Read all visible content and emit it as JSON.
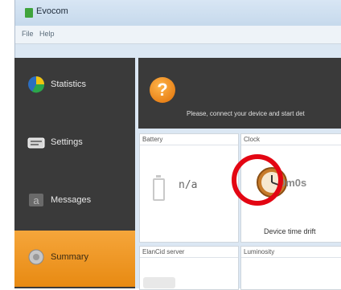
{
  "window": {
    "title": "Evocom"
  },
  "menu": [
    "File",
    "Help"
  ],
  "sidebar": {
    "items": [
      {
        "label": "Statistics",
        "icon": "statistics-icon",
        "active": false
      },
      {
        "label": "Settings",
        "icon": "settings-icon",
        "active": false
      },
      {
        "label": "Messages",
        "icon": "messages-icon",
        "active": false
      },
      {
        "label": "Summary",
        "icon": "summary-icon",
        "active": true
      }
    ]
  },
  "banner": {
    "icon": "question-icon",
    "icon_text": "?",
    "message": "Please, connect your device and start det"
  },
  "panels": {
    "battery": {
      "title": "Battery",
      "value": "n/a"
    },
    "clock": {
      "title": "Clock",
      "value": "0m0s",
      "caption": "Device time drift"
    },
    "elancid": {
      "title": "ElanCid server"
    },
    "luminosity": {
      "title": "Luminosity"
    }
  },
  "colors": {
    "accent": "#f29d2a",
    "sidebar_bg": "#3a3a3a",
    "highlight": "#e30613"
  }
}
